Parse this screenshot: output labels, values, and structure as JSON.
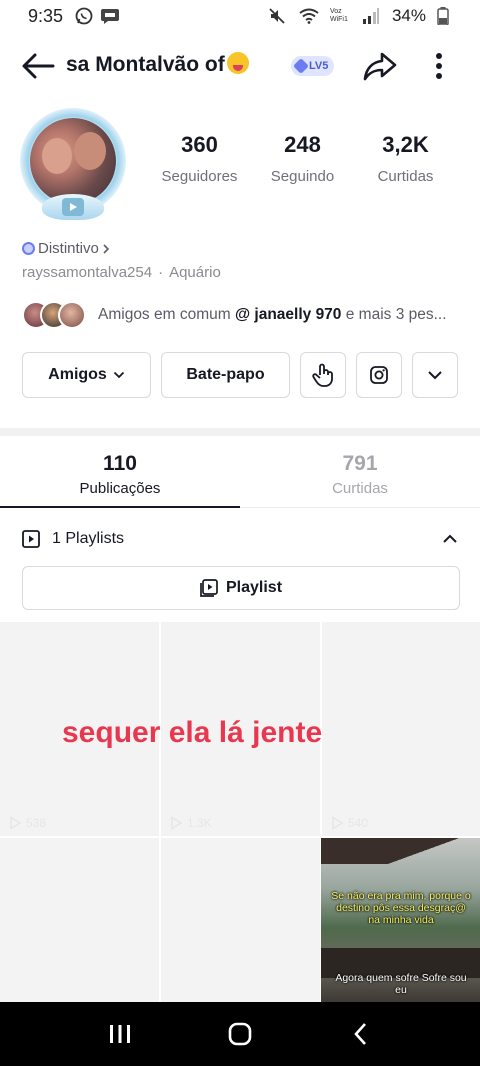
{
  "status_bar": {
    "time": "9:35",
    "battery": "34%",
    "volte_label": "Voz WiFi1"
  },
  "header": {
    "title": "sa Montalvão of",
    "level_badge": "LV5"
  },
  "profile": {
    "stats": [
      {
        "value": "360",
        "label": "Seguidores"
      },
      {
        "value": "248",
        "label": "Seguindo"
      },
      {
        "value": "3,2K",
        "label": "Curtidas"
      }
    ],
    "distintivo_label": "Distintivo",
    "username": "rayssamontalva254",
    "sign": "Aquário",
    "friends": {
      "prefix": "Amigos em comum",
      "mention": "@ janaelly 970",
      "suffix": "e mais 3 pes..."
    }
  },
  "actions": {
    "friends_button": "Amigos",
    "chat_button": "Bate-papo"
  },
  "tabs": [
    {
      "count": "110",
      "label": "Publicações"
    },
    {
      "count": "791",
      "label": "Curtidas"
    }
  ],
  "playlists": {
    "header_label": "1 Playlists",
    "button_label": "Playlist"
  },
  "overlay_caption": "sequer ela lá jente",
  "grid": {
    "plays": [
      "538",
      "1.3K",
      "540"
    ],
    "video_caption_top": "Se não era pra mim, porque o destino pôs essa desgraç@ na minha vida",
    "video_caption_bottom": "Agora quem sofre Sofre sou eu"
  },
  "colors": {
    "accent_red": "#e8384f",
    "badge_blue": "#6b7cf0"
  }
}
